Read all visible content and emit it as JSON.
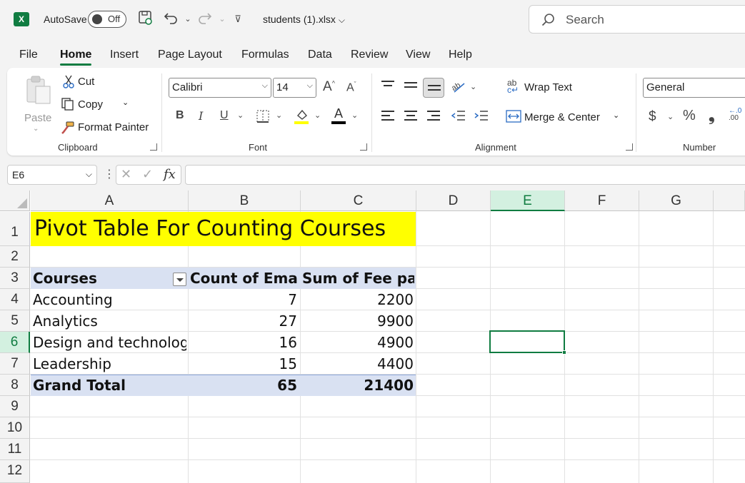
{
  "titlebar": {
    "app_icon": "excel-logo-icon",
    "autosave_label": "AutoSave",
    "autosave_state": "Off",
    "filename": "students (1).xlsx",
    "search_placeholder": "Search"
  },
  "menu": {
    "tabs": [
      "File",
      "Home",
      "Insert",
      "Page Layout",
      "Formulas",
      "Data",
      "Review",
      "View",
      "Help"
    ],
    "active": "Home"
  },
  "ribbon": {
    "clipboard": {
      "group_label": "Clipboard",
      "paste": "Paste",
      "cut": "Cut",
      "copy": "Copy",
      "format_painter": "Format Painter"
    },
    "font": {
      "group_label": "Font",
      "font_name": "Calibri",
      "font_size": "14",
      "bold": "B",
      "italic": "I",
      "underline": "U",
      "font_color_glyph": "A",
      "fill_color": "#ffff00",
      "text_color": "#000000"
    },
    "alignment": {
      "group_label": "Alignment",
      "wrap_text": "Wrap Text",
      "merge_center": "Merge & Center"
    },
    "number": {
      "group_label": "Number",
      "format": "General",
      "currency": "$",
      "percent": "%",
      "comma": "❟"
    }
  },
  "formula_bar": {
    "name_box": "E6",
    "fx": "fx",
    "value": ""
  },
  "grid": {
    "columns": [
      "A",
      "B",
      "C",
      "D",
      "E",
      "F",
      "G"
    ],
    "rows": [
      "1",
      "2",
      "3",
      "4",
      "5",
      "6",
      "7",
      "8",
      "9",
      "10",
      "11",
      "12"
    ],
    "selected_column": "E",
    "selected_row": "6",
    "title": "Pivot Table For Counting Courses",
    "title_fill": "#ffff00",
    "pivot": {
      "header_fill": "#d9e1f2",
      "headers": [
        "Courses",
        "Count of Emails",
        "Sum of Fee paid"
      ],
      "rows": [
        {
          "course": "Accounting",
          "count": "7",
          "sum": "2200"
        },
        {
          "course": "Analytics",
          "count": "27",
          "sum": "9900"
        },
        {
          "course": "Design and technology",
          "count": "16",
          "sum": "4900"
        },
        {
          "course": "Leadership",
          "count": "15",
          "sum": "4400"
        }
      ],
      "total": {
        "label": "Grand Total",
        "count": "65",
        "sum": "21400"
      }
    }
  }
}
